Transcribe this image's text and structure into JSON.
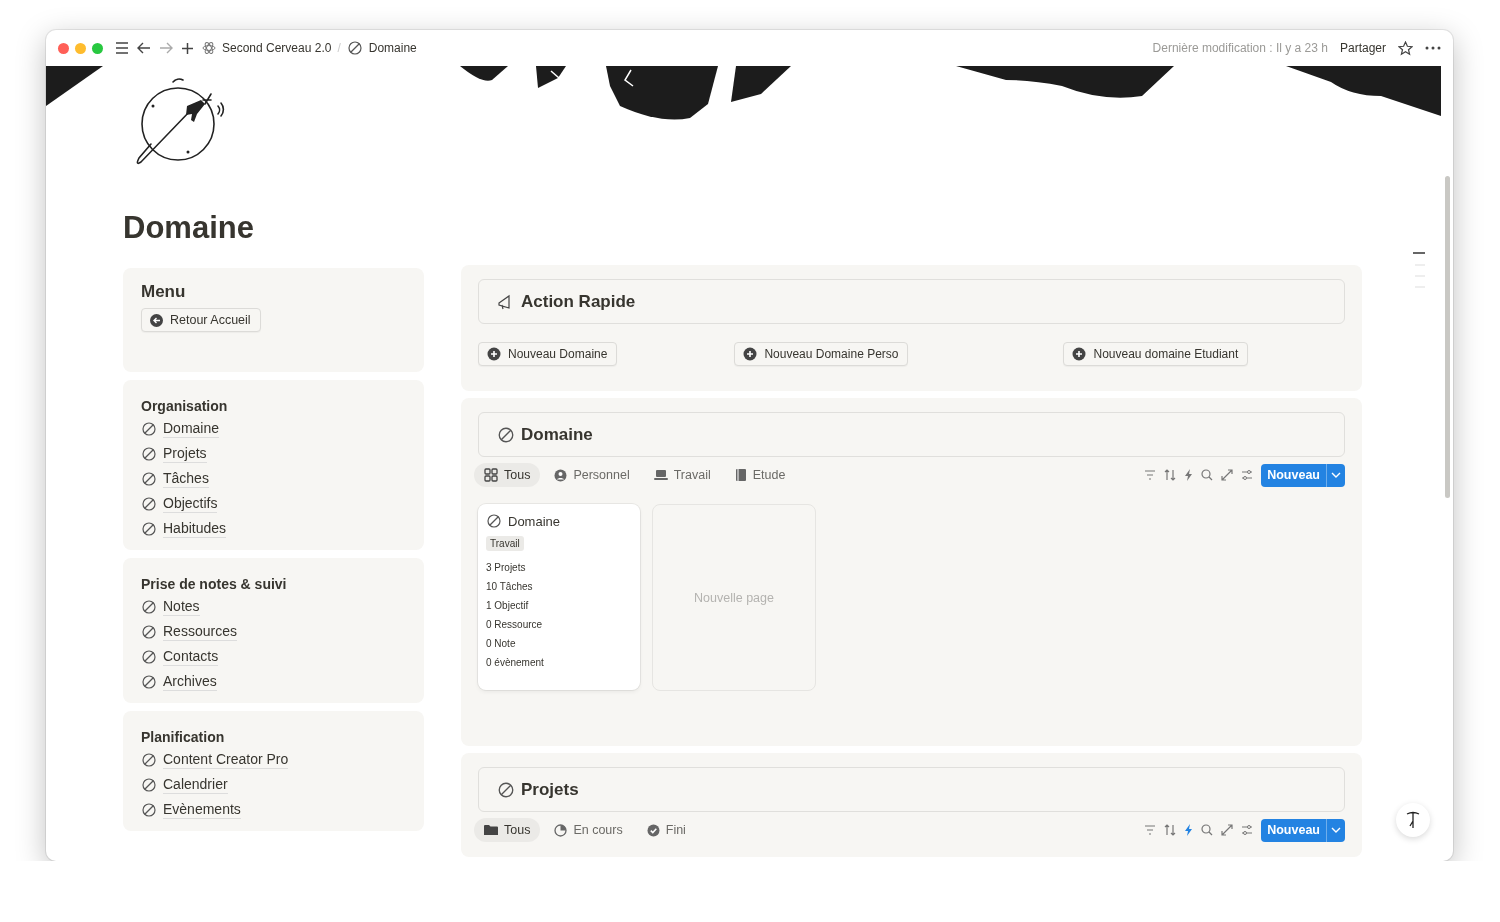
{
  "breadcrumb": [
    {
      "label": "Second Cerveau 2.0"
    },
    {
      "label": "Domaine"
    }
  ],
  "breadcrumb_separator": "/",
  "topbar": {
    "last_edited": "Dernière modification : Il y a 23 h",
    "share": "Partager"
  },
  "title": "Domaine",
  "menu": {
    "title": "Menu",
    "button": "Retour Accueil"
  },
  "sidebar_sections": [
    {
      "title": "Organisation",
      "links": [
        "Domaine",
        "Projets",
        "Tâches",
        "Objectifs",
        "Habitudes"
      ]
    },
    {
      "title": "Prise de notes & suivi",
      "links": [
        "Notes",
        "Ressources",
        "Contacts",
        "Archives"
      ]
    },
    {
      "title": "Planification",
      "links": [
        "Content Creator Pro",
        "Calendrier",
        "Evènements"
      ]
    }
  ],
  "quick_actions": {
    "title": "Action Rapide",
    "buttons": [
      "Nouveau Domaine",
      "Nouveau Domaine Perso",
      "Nouveau domaine Etudiant"
    ]
  },
  "databases": [
    {
      "title": "Domaine",
      "automation_active": false,
      "new_button": "Nouveau",
      "views": [
        {
          "label": "Tous",
          "kind": "grid",
          "selected": true
        },
        {
          "label": "Personnel",
          "kind": "person",
          "selected": false
        },
        {
          "label": "Travail",
          "kind": "laptop",
          "selected": false
        },
        {
          "label": "Etude",
          "kind": "book",
          "selected": false
        }
      ],
      "cards": [
        {
          "title": "Domaine",
          "tag": "Travail",
          "lines": [
            "3 Projets",
            "10 Tâches",
            "1 Objectif",
            "0 Ressource",
            "0 Note",
            "0 évènement"
          ]
        }
      ],
      "new_page": "Nouvelle page"
    },
    {
      "title": "Projets",
      "automation_active": true,
      "new_button": "Nouveau",
      "views": [
        {
          "label": "Tous",
          "kind": "folder",
          "selected": true
        },
        {
          "label": "En cours",
          "kind": "pie",
          "selected": false
        },
        {
          "label": "Fini",
          "kind": "check",
          "selected": false
        }
      ]
    }
  ]
}
